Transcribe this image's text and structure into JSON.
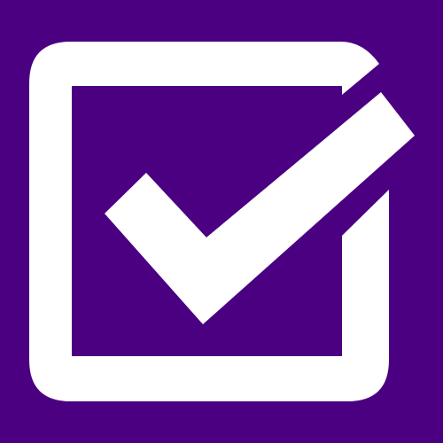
{
  "icon": {
    "name": "checked-checkbox-icon",
    "state": "checked"
  },
  "colors": {
    "background": "#4B0082",
    "foreground": "#FFFFFF"
  }
}
